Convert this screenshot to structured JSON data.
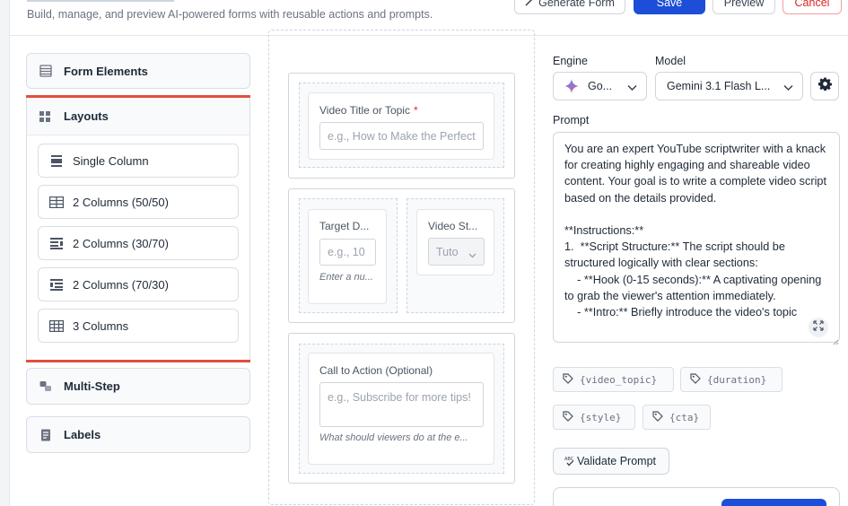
{
  "header": {
    "subtitle": "Build, manage, and preview AI-powered forms with reusable actions and prompts.",
    "buttons": {
      "generate": "Generate Form",
      "save": "Save",
      "preview": "Preview",
      "cancel": "Cancel"
    }
  },
  "sidebar": {
    "form_elements": "Form Elements",
    "layouts": {
      "title": "Layouts",
      "items": [
        {
          "label": "Single Column",
          "icon": "single-column-icon"
        },
        {
          "label": "2 Columns (50/50)",
          "icon": "two-columns-50-50-icon"
        },
        {
          "label": "2 Columns (30/70)",
          "icon": "two-columns-30-70-icon"
        },
        {
          "label": "2 Columns (70/30)",
          "icon": "two-columns-70-30-icon"
        },
        {
          "label": "3 Columns",
          "icon": "three-columns-icon"
        }
      ]
    },
    "multi_step": "Multi-Step",
    "labels": "Labels"
  },
  "canvas": {
    "video_title": {
      "label": "Video Title or Topic",
      "required_mark": "*",
      "placeholder": "e.g., How to Make the Perfect"
    },
    "target_duration": {
      "label": "Target D...",
      "placeholder": "e.g., 10",
      "help": "Enter a nu..."
    },
    "video_style": {
      "label": "Video St...",
      "value": "Tuto"
    },
    "cta": {
      "label": "Call to Action (Optional)",
      "placeholder": "e.g., Subscribe for more tips!",
      "help": "What should viewers do at the e..."
    }
  },
  "config": {
    "engine_label": "Engine",
    "engine_value": "Go...",
    "model_label": "Model",
    "model_value": "Gemini 3.1 Flash L...",
    "prompt_label": "Prompt",
    "prompt_text": "You are an expert YouTube scriptwriter with a knack for creating highly engaging and shareable video content. Your goal is to write a complete video script based on the details provided.\n\n**Instructions:**\n1.  **Script Structure:** The script should be structured logically with clear sections:\n    - **Hook (0-15 seconds):** A captivating opening to grab the viewer's attention immediately.\n    - **Intro:** Briefly introduce the video's topic",
    "tags": [
      "{video_topic}",
      "{duration}",
      "{style}",
      "{cta}"
    ],
    "validate_label": "Validate Prompt",
    "accent_color": "#1d4ed8",
    "active_border_color": "#e04f3f"
  }
}
